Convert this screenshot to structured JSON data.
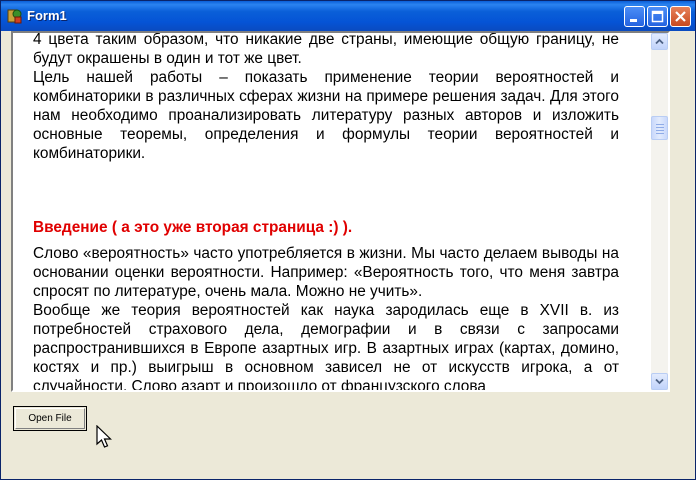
{
  "window": {
    "title": "Form1",
    "icon": "delphi-app-icon",
    "controls": {
      "minimize": "minimize-icon",
      "maximize": "maximize-icon",
      "close": "close-icon"
    }
  },
  "document": {
    "paragraphs": [
      "4 цвета таким образом, что никакие две страны, имеющие общую границу, не будут окрашены в один и тот же цвет.",
      "Цель нашей работы – показать применение теории вероятностей и комбинаторики в различных сферах жизни на примере решения задач. Для этого нам необходимо проанализировать литературу разных авторов и изложить основные теоремы, определения и формулы теории вероятностей и комбинаторики."
    ],
    "heading": "Введение ( а это уже вторая страница :) ).",
    "heading_color": "#e00000",
    "paragraphs2": [
      "Слово «вероятность» часто употребляется в жизни. Мы часто делаем выводы на основании оценки вероятности. Например: «Вероятность того, что меня завтра спросят по литературе, очень мала. Можно не учить».",
      "Вообще же теория вероятностей как наука зародилась еще в XVII в. из потребностей страхового дела, демографии и в связи с запросами распространившихся в Европе азартных игр. В азартных играх (картах, домино, костях и пр.) выигрыш в основном зависел не от искусств игрока, а от случайности. Слово азарт и произошло от французского слова"
    ]
  },
  "scrollbar": {
    "position": 0.22
  },
  "buttons": {
    "open_file": "Open File"
  }
}
